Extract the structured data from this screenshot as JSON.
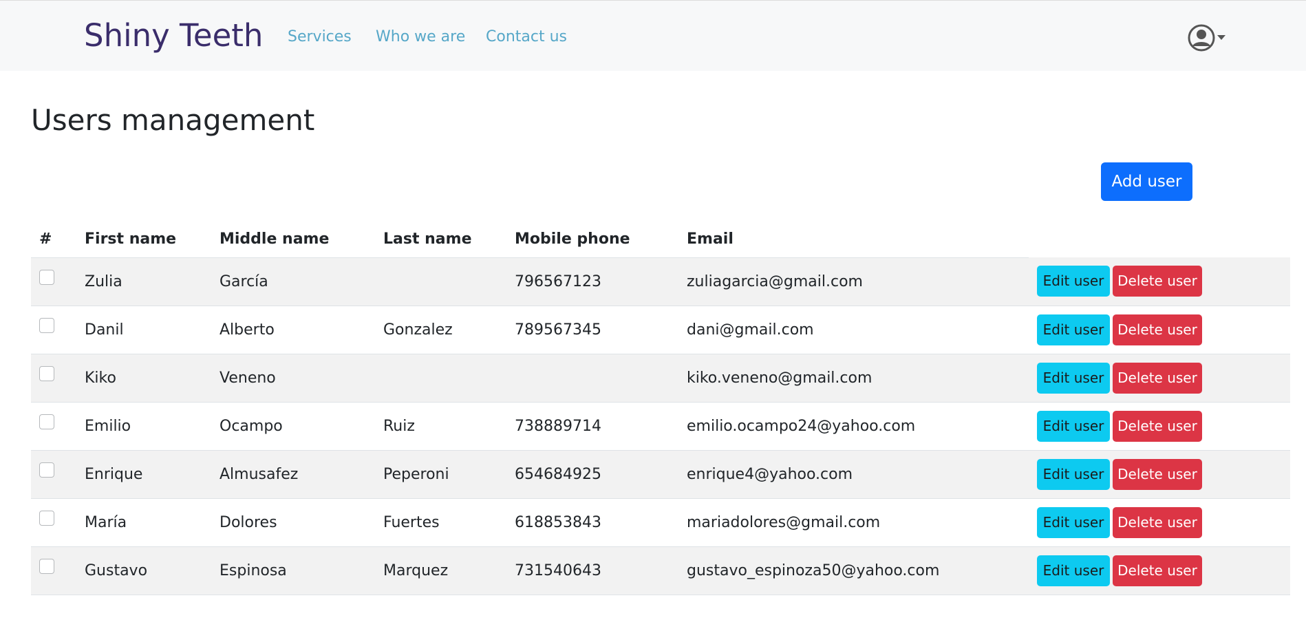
{
  "navbar": {
    "brand": "Shiny Teeth",
    "links": [
      {
        "label": "Services"
      },
      {
        "label": "Who we are"
      },
      {
        "label": "Contact us"
      }
    ],
    "user_icon": "user-circle-icon",
    "caret_icon": "caret-down-icon"
  },
  "page": {
    "title": "Users management",
    "add_user_label": "Add user"
  },
  "table": {
    "headers": [
      "#",
      "First name",
      "Middle name",
      "Last name",
      "Mobile phone",
      "Email",
      ""
    ],
    "rows": [
      {
        "first": "Zulia",
        "middle": "García",
        "last": "",
        "phone": "796567123",
        "email": "zuliagarcia@gmail.com"
      },
      {
        "first": "Danil",
        "middle": "Alberto",
        "last": "Gonzalez",
        "phone": "789567345",
        "email": "dani@gmail.com"
      },
      {
        "first": "Kiko",
        "middle": "Veneno",
        "last": "",
        "phone": "",
        "email": "kiko.veneno@gmail.com"
      },
      {
        "first": "Emilio",
        "middle": "Ocampo",
        "last": "Ruiz",
        "phone": "738889714",
        "email": "emilio.ocampo24@yahoo.com"
      },
      {
        "first": "Enrique",
        "middle": "Almusafez",
        "last": "Peperoni",
        "phone": "654684925",
        "email": "enrique4@yahoo.com"
      },
      {
        "first": "María",
        "middle": "Dolores",
        "last": "Fuertes",
        "phone": "618853843",
        "email": "mariadolores@gmail.com"
      },
      {
        "first": "Gustavo",
        "middle": "Espinosa",
        "last": "Marquez",
        "phone": "731540643",
        "email": "gustavo_espinoza50@yahoo.com"
      }
    ],
    "edit_label": "Edit user",
    "delete_label": "Delete user"
  },
  "colors": {
    "brand": "#3a2d6b",
    "nav_link": "#56a7c8",
    "primary": "#0d6efd",
    "info": "#0dcaf0",
    "danger": "#dc3545"
  }
}
